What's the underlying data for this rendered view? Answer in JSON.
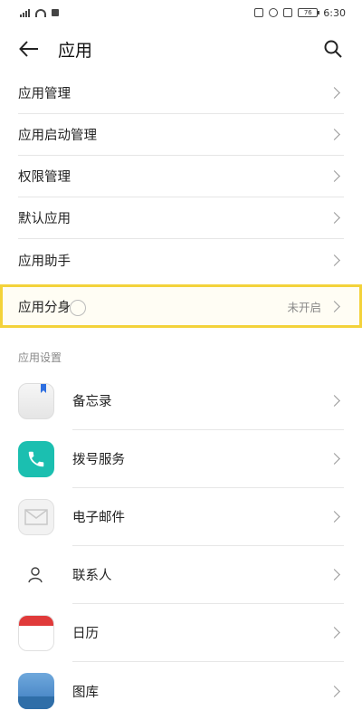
{
  "status": {
    "time": "6:30",
    "battery": "76"
  },
  "header": {
    "title": "应用"
  },
  "menu": {
    "items": [
      {
        "label": "应用管理"
      },
      {
        "label": "应用启动管理"
      },
      {
        "label": "权限管理"
      },
      {
        "label": "默认应用"
      },
      {
        "label": "应用助手"
      }
    ],
    "highlighted": {
      "label": "应用分身",
      "value": "未开启"
    }
  },
  "section": {
    "label": "应用设置"
  },
  "apps": [
    {
      "label": "备忘录",
      "icon": "memo-icon"
    },
    {
      "label": "拨号服务",
      "icon": "phone-icon"
    },
    {
      "label": "电子邮件",
      "icon": "mail-icon"
    },
    {
      "label": "联系人",
      "icon": "contact-icon"
    },
    {
      "label": "日历",
      "icon": "calendar-icon"
    },
    {
      "label": "图库",
      "icon": "gallery-icon"
    }
  ],
  "colors": {
    "highlight_border": "#f3d23a",
    "phone_icon": "#1bbfb0",
    "calendar_header": "#e03a3a"
  }
}
